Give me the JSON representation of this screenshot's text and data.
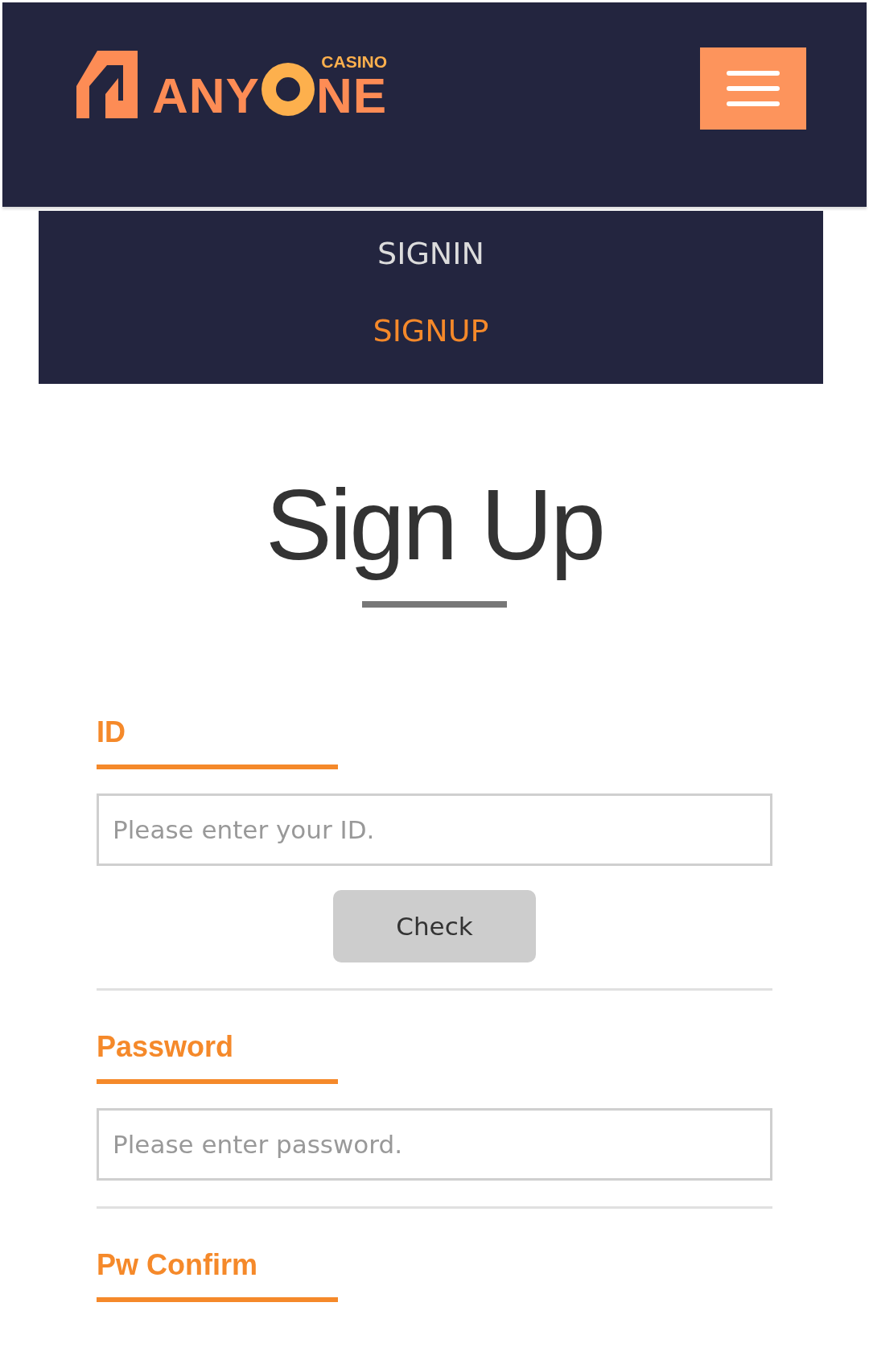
{
  "header": {
    "logo": {
      "part_1": "ANY",
      "part_2": "NE",
      "badge": "CASINO"
    }
  },
  "nav": {
    "items": [
      {
        "label": "SIGNIN",
        "selected": false
      },
      {
        "label": "SIGNUP",
        "selected": true
      }
    ]
  },
  "title": "Sign Up",
  "fields": [
    {
      "label": "ID",
      "placeholder": "Please enter your ID.",
      "button": "Check"
    },
    {
      "label": "Password",
      "placeholder": "Please enter password."
    },
    {
      "label": "Pw Confirm"
    }
  ]
}
